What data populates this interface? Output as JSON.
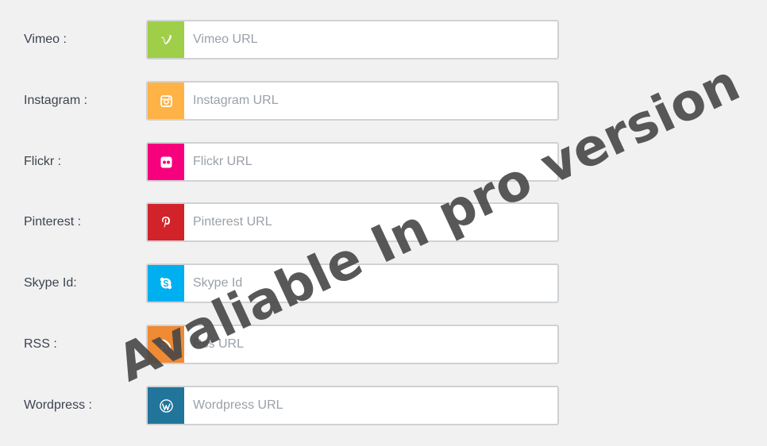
{
  "rows": [
    {
      "label": "Vimeo :",
      "placeholder": "Vimeo URL",
      "icon": "vimeo-icon",
      "color": "#9fcf48"
    },
    {
      "label": "Instagram :",
      "placeholder": "Instagram URL",
      "icon": "instagram-icon",
      "color": "#ffb347"
    },
    {
      "label": "Flickr :",
      "placeholder": "Flickr URL",
      "icon": "flickr-icon",
      "color": "#f7007e"
    },
    {
      "label": "Pinterest :",
      "placeholder": "Pinterest URL",
      "icon": "pinterest-icon",
      "color": "#d2232a"
    },
    {
      "label": "Skype Id:",
      "placeholder": "Skype Id",
      "icon": "skype-icon",
      "color": "#00aff0"
    },
    {
      "label": "RSS :",
      "placeholder": "Rss URL",
      "icon": "rss-icon",
      "color": "#f08a33"
    },
    {
      "label": "Wordpress :",
      "placeholder": "Wordpress URL",
      "icon": "wordpress-icon",
      "color": "#21759b"
    }
  ],
  "watermark": "Avaliable In pro version"
}
